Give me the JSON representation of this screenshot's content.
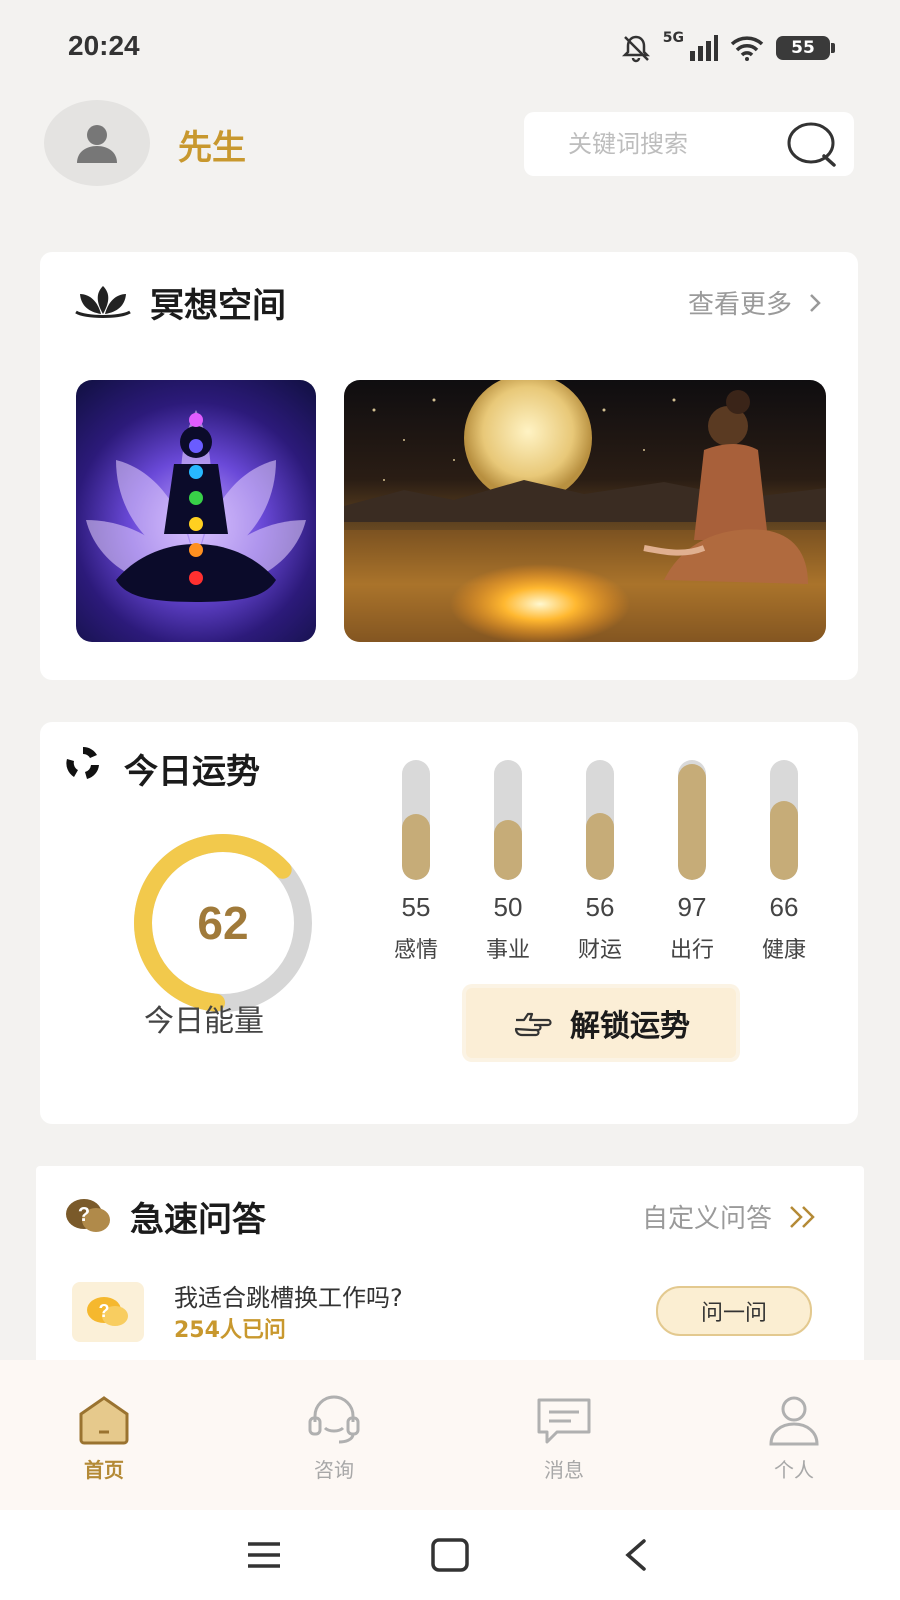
{
  "status_bar": {
    "time": "20:24",
    "network": "5G",
    "battery": "55"
  },
  "header": {
    "user_name": "先生",
    "search_placeholder": "关键词搜索"
  },
  "meditation": {
    "title": "冥想空间",
    "more_label": "查看更多"
  },
  "fortune": {
    "title": "今日运势",
    "energy_value": "62",
    "energy_fraction": 0.62,
    "energy_label": "今日能量",
    "bars": [
      {
        "value": "55",
        "label": "感情"
      },
      {
        "value": "50",
        "label": "事业"
      },
      {
        "value": "56",
        "label": "财运"
      },
      {
        "value": "97",
        "label": "出行"
      },
      {
        "value": "66",
        "label": "健康"
      }
    ],
    "unlock_label": "解锁运势"
  },
  "qa": {
    "title": "急速问答",
    "custom_label": "自定义问答",
    "question": "我适合跳槽换工作吗?",
    "asked_count": "254人已问",
    "ask_button": "问一问"
  },
  "tabs": [
    {
      "label": "首页",
      "icon": "home-icon",
      "active": true
    },
    {
      "label": "咨询",
      "icon": "headset-icon",
      "active": false
    },
    {
      "label": "消息",
      "icon": "message-icon",
      "active": false
    },
    {
      "label": "个人",
      "icon": "person-icon",
      "active": false
    }
  ],
  "colors": {
    "accent_gold": "#c8982e",
    "bar_fill": "#c6ac78",
    "ring_yellow": "#f2c94c",
    "ring_gray": "#d6d6d6"
  }
}
